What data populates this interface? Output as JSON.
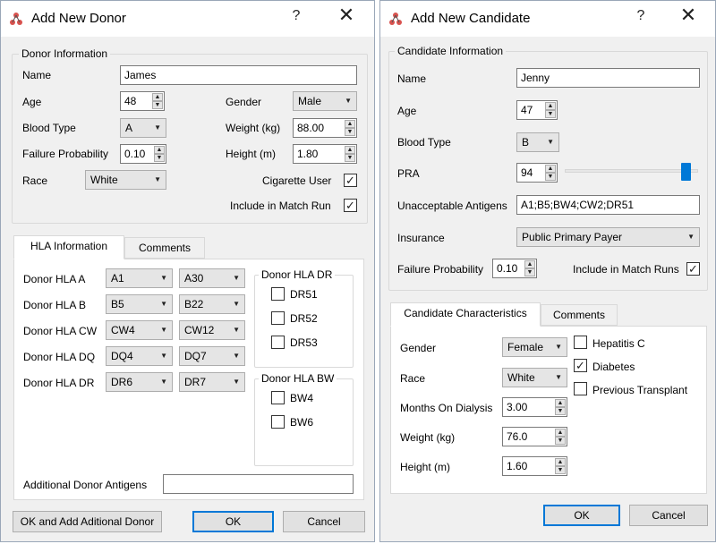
{
  "donor_window": {
    "title": "Add New Donor",
    "help": "?",
    "close": "✕",
    "group_title": "Donor Information",
    "name_label": "Name",
    "name_value": "James",
    "age_label": "Age",
    "age_value": "48",
    "gender_label": "Gender",
    "gender_value": "Male",
    "blood_type_label": "Blood Type",
    "blood_type_value": "A",
    "weight_label": "Weight (kg)",
    "weight_value": "88.00",
    "failure_label": "Failure Probability",
    "failure_value": "0.10",
    "height_label": "Height (m)",
    "height_value": "1.80",
    "race_label": "Race",
    "race_value": "White",
    "cigarette_label": "Cigarette User",
    "cigarette_checked": true,
    "include_label": "Include in Match Run",
    "include_checked": true,
    "tabs": [
      "HLA Information",
      "Comments"
    ],
    "hla_rows": [
      {
        "label": "Donor HLA A",
        "v1": "A1",
        "v2": "A30"
      },
      {
        "label": "Donor HLA B",
        "v1": "B5",
        "v2": "B22"
      },
      {
        "label": "Donor HLA CW",
        "v1": "CW4",
        "v2": "CW12"
      },
      {
        "label": "Donor HLA DQ",
        "v1": "DQ4",
        "v2": "DQ7"
      },
      {
        "label": "Donor HLA DR",
        "v1": "DR6",
        "v2": "DR7"
      }
    ],
    "dr_group_title": "Donor HLA DR",
    "dr_options": [
      "DR51",
      "DR52",
      "DR53"
    ],
    "bw_group_title": "Donor HLA BW",
    "bw_options": [
      "BW4",
      "BW6"
    ],
    "additional_label": "Additional Donor Antigens",
    "additional_value": "",
    "btn_ok_add": "OK and Add Aditional Donor",
    "btn_ok": "OK",
    "btn_cancel": "Cancel"
  },
  "candidate_window": {
    "title": "Add New Candidate",
    "help": "?",
    "close": "✕",
    "group_title": "Candidate Information",
    "name_label": "Name",
    "name_value": "Jenny",
    "age_label": "Age",
    "age_value": "47",
    "blood_type_label": "Blood Type",
    "blood_type_value": "B",
    "pra_label": "PRA",
    "pra_value": "94",
    "pra_slider_fraction": 0.94,
    "unacceptable_label": "Unacceptable Antigens",
    "unacceptable_value": "A1;B5;BW4;CW2;DR51",
    "insurance_label": "Insurance",
    "insurance_value": "Public Primary Payer",
    "failure_label": "Failure Probability",
    "failure_value": "0.10",
    "include_label": "Include in Match Runs",
    "include_checked": true,
    "tabs": [
      "Candidate Characteristics",
      "Comments"
    ],
    "gender_label": "Gender",
    "gender_value": "Female",
    "race_label": "Race",
    "race_value": "White",
    "dialysis_label": "Months On Dialysis",
    "dialysis_value": "3.00",
    "weight_label": "Weight (kg)",
    "weight_value": "76.0",
    "height_label": "Height (m)",
    "height_value": "1.60",
    "hepatitis_label": "Hepatitis C",
    "hepatitis_checked": false,
    "diabetes_label": "Diabetes",
    "diabetes_checked": true,
    "prev_transplant_label": "Previous Transplant",
    "prev_transplant_checked": false,
    "btn_ok": "OK",
    "btn_cancel": "Cancel"
  },
  "check_glyph": "✓",
  "spin_up_glyph": "▲",
  "spin_down_glyph": "▼",
  "combo_arrow_glyph": "▼",
  "colors": {
    "accent": "#0078d7",
    "window_bg": "#f0f0f0"
  }
}
